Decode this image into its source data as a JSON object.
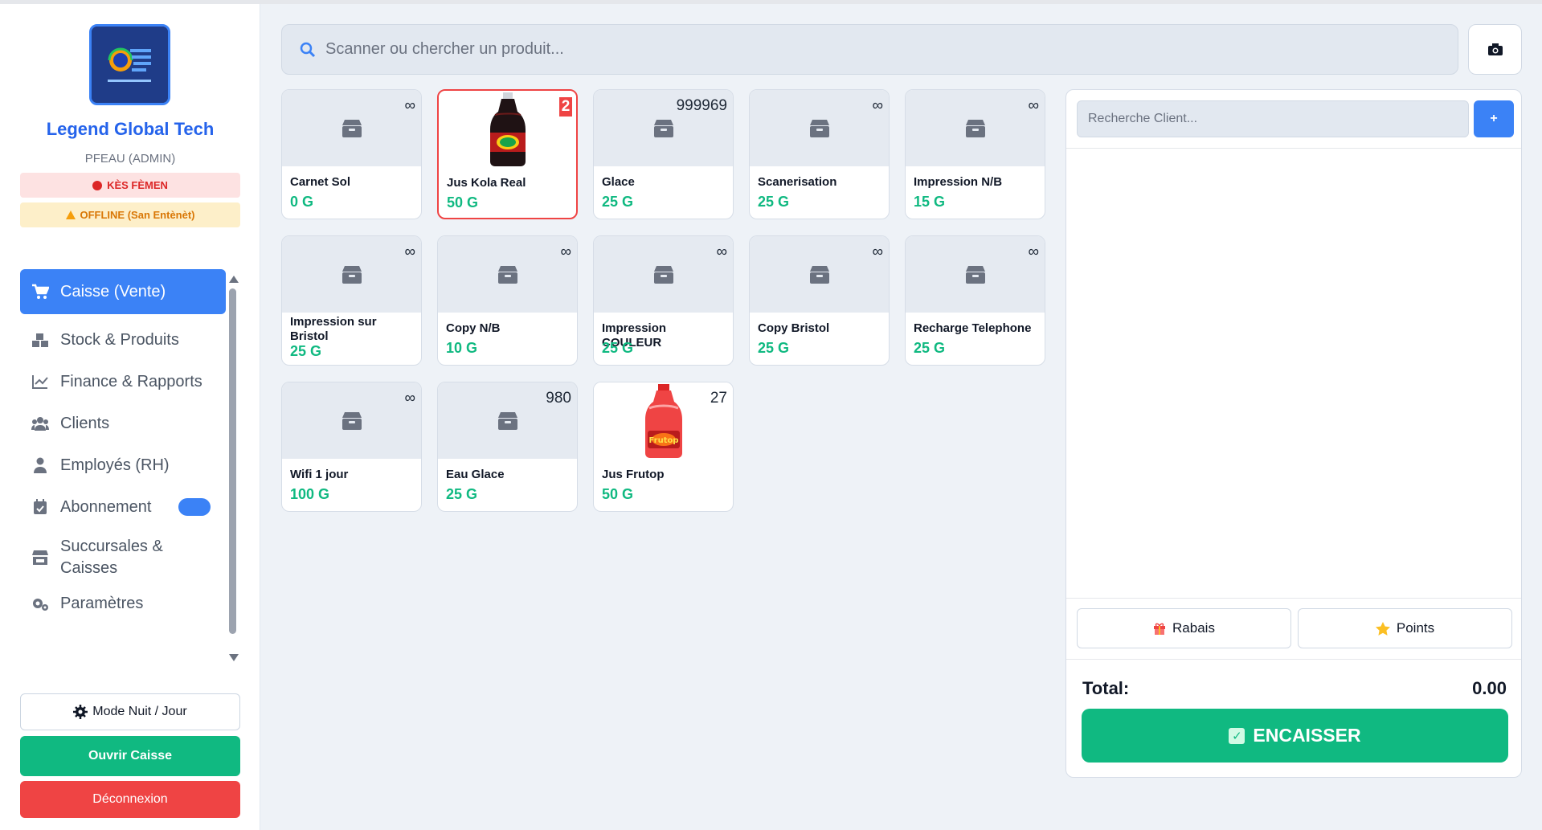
{
  "sidebar": {
    "brand": "Legend Global Tech",
    "user": "PFEAU (ADMIN)",
    "status_closed": "KÈS FÈMEN",
    "status_offline": "OFFLINE (San Entènèt)",
    "nav": [
      {
        "label": "Caisse (Vente)",
        "icon": "cart-icon",
        "active": true
      },
      {
        "label": "Stock & Produits",
        "icon": "boxes-icon"
      },
      {
        "label": "Finance & Rapports",
        "icon": "chart-line-icon"
      },
      {
        "label": "Clients",
        "icon": "users-icon"
      },
      {
        "label": "Employés (RH)",
        "icon": "user-tie-icon"
      },
      {
        "label": "Abonnement",
        "icon": "calendar-check-icon"
      },
      {
        "label": "Succursales &",
        "label2": "Caisses",
        "icon": "store-icon"
      },
      {
        "label": "Paramètres",
        "icon": "gears-icon"
      }
    ],
    "theme_button": "Mode Nuit / Jour",
    "open_register_button": "Ouvrir Caisse",
    "logout_button": "Déconnexion"
  },
  "search": {
    "placeholder": "Scanner ou chercher un produit..."
  },
  "products": [
    {
      "name": "Carnet Sol",
      "price": "0 G",
      "stock": "∞"
    },
    {
      "name": "Jus Kola Real",
      "price": "50 G",
      "stock": "2",
      "image": "bottle-kola",
      "selected": true
    },
    {
      "name": "Glace",
      "price": "25 G",
      "stock": "999969"
    },
    {
      "name": "Scanerisation",
      "price": "25 G",
      "stock": "∞"
    },
    {
      "name": "Impression N/B",
      "price": "15 G",
      "stock": "∞"
    },
    {
      "name": "Impression sur Bristol",
      "price": "25 G",
      "stock": "∞"
    },
    {
      "name": "Copy N/B",
      "price": "10 G",
      "stock": "∞"
    },
    {
      "name": "Impression COULEUR",
      "price": "25 G",
      "stock": "∞"
    },
    {
      "name": "Copy Bristol",
      "price": "25 G",
      "stock": "∞"
    },
    {
      "name": "Recharge Telephone",
      "price": "25 G",
      "stock": "∞"
    },
    {
      "name": "Wifi 1 jour",
      "price": "100 G",
      "stock": "∞"
    },
    {
      "name": "Eau Glace",
      "price": "25 G",
      "stock": "980"
    },
    {
      "name": "Jus Frutop",
      "price": "50 G",
      "stock": "27",
      "image": "bottle-frutop"
    }
  ],
  "cart": {
    "client_placeholder": "Recherche Client...",
    "add_client_label": "+",
    "discount_button": "Rabais",
    "points_button": "Points",
    "total_label": "Total:",
    "total_value": "0.00",
    "pay_button": "ENCAISSER"
  },
  "colors": {
    "accent": "#3b82f6",
    "success": "#10b981",
    "danger": "#ef4444",
    "warning": "#f59e0b"
  }
}
